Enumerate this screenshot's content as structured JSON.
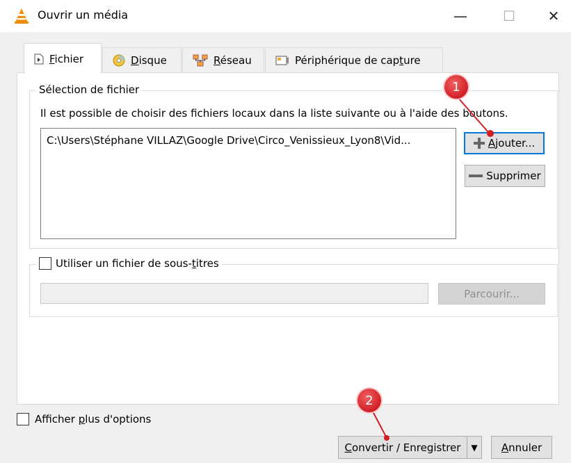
{
  "window": {
    "title": "Ouvrir un média",
    "controls": {
      "minimize": "—",
      "maximize": "☐",
      "close": "✕"
    }
  },
  "tabs": [
    {
      "pre": "",
      "key": "F",
      "post": "ichier"
    },
    {
      "pre": "",
      "key": "D",
      "post": "isque"
    },
    {
      "pre": "",
      "key": "R",
      "post": "éseau"
    },
    {
      "pre": "Périphérique de cap",
      "key": "t",
      "post": "ure"
    }
  ],
  "file_selection": {
    "legend": "Sélection de fichier",
    "description": "Il est possible de choisir des fichiers locaux dans la liste suivante ou à l'aide des boutons.",
    "files": [
      "C:\\Users\\Stéphane VILLAZ\\Google Drive\\Circo_Venissieux_Lyon8\\Vid..."
    ],
    "add_button": {
      "key": "A",
      "post": "jouter..."
    },
    "remove_button": "Supprimer"
  },
  "subtitles": {
    "pre": "Utiliser un fichier de sous-",
    "key": "t",
    "post": "itres",
    "path_value": "",
    "browse_button": "Parcourir..."
  },
  "footer": {
    "more_options": {
      "pre": "Afficher ",
      "key": "p",
      "post": "lus d'options"
    },
    "convert_button": {
      "key": "C",
      "post": "onvertir / Enregistrer"
    },
    "dropdown_arrow": "▼",
    "cancel_button": {
      "key": "A",
      "post": "nnuler"
    }
  },
  "annotations": [
    "1",
    "2"
  ],
  "colors": {
    "accent": "#0078d7",
    "badge_red": "#d21f26",
    "vlc_orange": "#f08c00"
  }
}
